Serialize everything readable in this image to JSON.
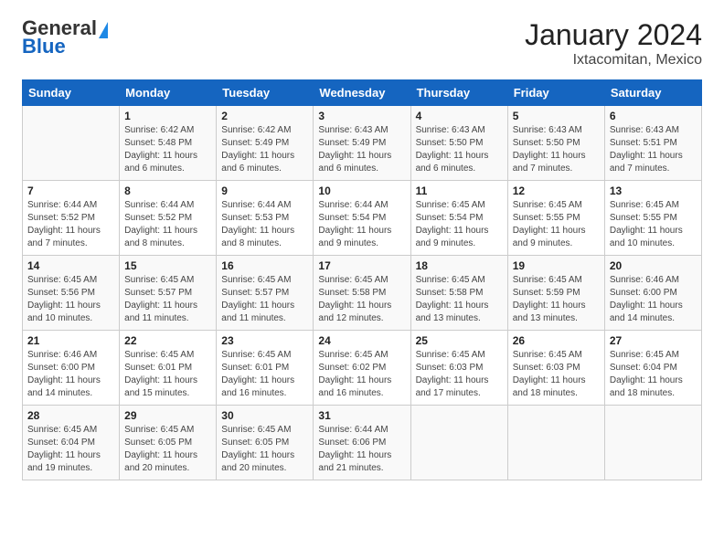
{
  "header": {
    "logo_general": "General",
    "logo_blue": "Blue",
    "title": "January 2024",
    "subtitle": "Ixtacomitan, Mexico"
  },
  "days_of_week": [
    "Sunday",
    "Monday",
    "Tuesday",
    "Wednesday",
    "Thursday",
    "Friday",
    "Saturday"
  ],
  "weeks": [
    [
      {
        "day": "",
        "sunrise": "",
        "sunset": "",
        "daylight": ""
      },
      {
        "day": "1",
        "sunrise": "Sunrise: 6:42 AM",
        "sunset": "Sunset: 5:48 PM",
        "daylight": "Daylight: 11 hours and 6 minutes."
      },
      {
        "day": "2",
        "sunrise": "Sunrise: 6:42 AM",
        "sunset": "Sunset: 5:49 PM",
        "daylight": "Daylight: 11 hours and 6 minutes."
      },
      {
        "day": "3",
        "sunrise": "Sunrise: 6:43 AM",
        "sunset": "Sunset: 5:49 PM",
        "daylight": "Daylight: 11 hours and 6 minutes."
      },
      {
        "day": "4",
        "sunrise": "Sunrise: 6:43 AM",
        "sunset": "Sunset: 5:50 PM",
        "daylight": "Daylight: 11 hours and 6 minutes."
      },
      {
        "day": "5",
        "sunrise": "Sunrise: 6:43 AM",
        "sunset": "Sunset: 5:50 PM",
        "daylight": "Daylight: 11 hours and 7 minutes."
      },
      {
        "day": "6",
        "sunrise": "Sunrise: 6:43 AM",
        "sunset": "Sunset: 5:51 PM",
        "daylight": "Daylight: 11 hours and 7 minutes."
      }
    ],
    [
      {
        "day": "7",
        "sunrise": "Sunrise: 6:44 AM",
        "sunset": "Sunset: 5:52 PM",
        "daylight": "Daylight: 11 hours and 7 minutes."
      },
      {
        "day": "8",
        "sunrise": "Sunrise: 6:44 AM",
        "sunset": "Sunset: 5:52 PM",
        "daylight": "Daylight: 11 hours and 8 minutes."
      },
      {
        "day": "9",
        "sunrise": "Sunrise: 6:44 AM",
        "sunset": "Sunset: 5:53 PM",
        "daylight": "Daylight: 11 hours and 8 minutes."
      },
      {
        "day": "10",
        "sunrise": "Sunrise: 6:44 AM",
        "sunset": "Sunset: 5:54 PM",
        "daylight": "Daylight: 11 hours and 9 minutes."
      },
      {
        "day": "11",
        "sunrise": "Sunrise: 6:45 AM",
        "sunset": "Sunset: 5:54 PM",
        "daylight": "Daylight: 11 hours and 9 minutes."
      },
      {
        "day": "12",
        "sunrise": "Sunrise: 6:45 AM",
        "sunset": "Sunset: 5:55 PM",
        "daylight": "Daylight: 11 hours and 9 minutes."
      },
      {
        "day": "13",
        "sunrise": "Sunrise: 6:45 AM",
        "sunset": "Sunset: 5:55 PM",
        "daylight": "Daylight: 11 hours and 10 minutes."
      }
    ],
    [
      {
        "day": "14",
        "sunrise": "Sunrise: 6:45 AM",
        "sunset": "Sunset: 5:56 PM",
        "daylight": "Daylight: 11 hours and 10 minutes."
      },
      {
        "day": "15",
        "sunrise": "Sunrise: 6:45 AM",
        "sunset": "Sunset: 5:57 PM",
        "daylight": "Daylight: 11 hours and 11 minutes."
      },
      {
        "day": "16",
        "sunrise": "Sunrise: 6:45 AM",
        "sunset": "Sunset: 5:57 PM",
        "daylight": "Daylight: 11 hours and 11 minutes."
      },
      {
        "day": "17",
        "sunrise": "Sunrise: 6:45 AM",
        "sunset": "Sunset: 5:58 PM",
        "daylight": "Daylight: 11 hours and 12 minutes."
      },
      {
        "day": "18",
        "sunrise": "Sunrise: 6:45 AM",
        "sunset": "Sunset: 5:58 PM",
        "daylight": "Daylight: 11 hours and 13 minutes."
      },
      {
        "day": "19",
        "sunrise": "Sunrise: 6:45 AM",
        "sunset": "Sunset: 5:59 PM",
        "daylight": "Daylight: 11 hours and 13 minutes."
      },
      {
        "day": "20",
        "sunrise": "Sunrise: 6:46 AM",
        "sunset": "Sunset: 6:00 PM",
        "daylight": "Daylight: 11 hours and 14 minutes."
      }
    ],
    [
      {
        "day": "21",
        "sunrise": "Sunrise: 6:46 AM",
        "sunset": "Sunset: 6:00 PM",
        "daylight": "Daylight: 11 hours and 14 minutes."
      },
      {
        "day": "22",
        "sunrise": "Sunrise: 6:45 AM",
        "sunset": "Sunset: 6:01 PM",
        "daylight": "Daylight: 11 hours and 15 minutes."
      },
      {
        "day": "23",
        "sunrise": "Sunrise: 6:45 AM",
        "sunset": "Sunset: 6:01 PM",
        "daylight": "Daylight: 11 hours and 16 minutes."
      },
      {
        "day": "24",
        "sunrise": "Sunrise: 6:45 AM",
        "sunset": "Sunset: 6:02 PM",
        "daylight": "Daylight: 11 hours and 16 minutes."
      },
      {
        "day": "25",
        "sunrise": "Sunrise: 6:45 AM",
        "sunset": "Sunset: 6:03 PM",
        "daylight": "Daylight: 11 hours and 17 minutes."
      },
      {
        "day": "26",
        "sunrise": "Sunrise: 6:45 AM",
        "sunset": "Sunset: 6:03 PM",
        "daylight": "Daylight: 11 hours and 18 minutes."
      },
      {
        "day": "27",
        "sunrise": "Sunrise: 6:45 AM",
        "sunset": "Sunset: 6:04 PM",
        "daylight": "Daylight: 11 hours and 18 minutes."
      }
    ],
    [
      {
        "day": "28",
        "sunrise": "Sunrise: 6:45 AM",
        "sunset": "Sunset: 6:04 PM",
        "daylight": "Daylight: 11 hours and 19 minutes."
      },
      {
        "day": "29",
        "sunrise": "Sunrise: 6:45 AM",
        "sunset": "Sunset: 6:05 PM",
        "daylight": "Daylight: 11 hours and 20 minutes."
      },
      {
        "day": "30",
        "sunrise": "Sunrise: 6:45 AM",
        "sunset": "Sunset: 6:05 PM",
        "daylight": "Daylight: 11 hours and 20 minutes."
      },
      {
        "day": "31",
        "sunrise": "Sunrise: 6:44 AM",
        "sunset": "Sunset: 6:06 PM",
        "daylight": "Daylight: 11 hours and 21 minutes."
      },
      {
        "day": "",
        "sunrise": "",
        "sunset": "",
        "daylight": ""
      },
      {
        "day": "",
        "sunrise": "",
        "sunset": "",
        "daylight": ""
      },
      {
        "day": "",
        "sunrise": "",
        "sunset": "",
        "daylight": ""
      }
    ]
  ]
}
